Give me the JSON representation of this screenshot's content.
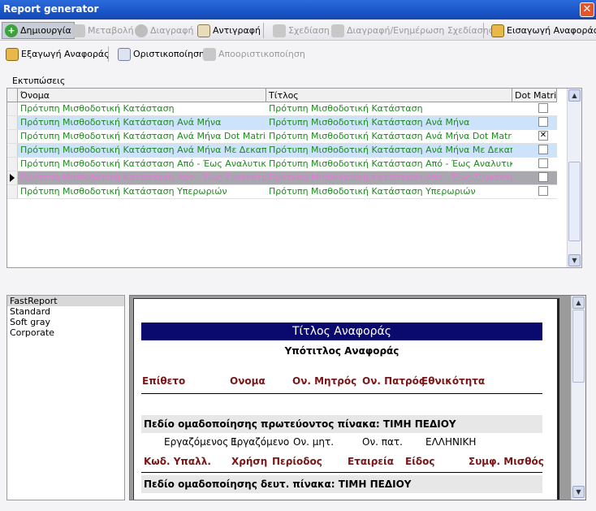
{
  "window": {
    "title": "Report generator",
    "close": "✕"
  },
  "toolbar1": {
    "create": "Δημιουργία",
    "edit": "Μεταβολή",
    "delete": "Διαγραφή",
    "copy": "Αντιγραφή",
    "design": "Σχεδίαση",
    "delete_update_design": "Διαγραφή/Ενημέρωση Σχεδίασης",
    "import": "Εισαγωγή Αναφοράς"
  },
  "toolbar2": {
    "export": "Εξαγωγή Αναφοράς",
    "finalize": "Οριστικοποίηση",
    "unfinalize": "Αποοριστικοποίηση"
  },
  "prints_label": "Εκτυπώσεις",
  "grid": {
    "columns": [
      "Όνομα",
      "Τίτλος",
      "Dot Matrix"
    ],
    "rows": [
      {
        "name": "Πρότυπη Μισθοδοτική Κατάσταση",
        "title": "Πρότυπη Μισθοδοτική Κατάσταση",
        "dot": ""
      },
      {
        "name": "Πρότυπη Μισθοδοτική Κατάσταση Ανά Μήνα",
        "title": "Πρότυπη Μισθοδοτική Κατάσταση Ανά Μήνα",
        "dot": ""
      },
      {
        "name": "Πρότυπη Μισθοδοτική Κατάσταση Ανά Μήνα Dot Matrix",
        "title": "Πρότυπη Μισθοδοτική Κατάσταση Ανά Μήνα Dot Matrix",
        "dot": "✕"
      },
      {
        "name": "Πρότυπη Μισθοδοτική Κατάσταση Ανά Μήνα Με Δεκαπενθήμερο",
        "title": "Πρότυπη Μισθοδοτική Κατάσταση Ανά Μήνα Με Δεκαπενθήμερο",
        "dot": ""
      },
      {
        "name": "Πρότυπη Μισθοδοτική Κατάσταση Από - Έως Αναλυτική",
        "title": "Πρότυπη Μισθοδοτική Κατάσταση Από - Έως Αναλυτική",
        "dot": ""
      },
      {
        "name": "Πρότυπη Μισθοδοτική Κατάσταση Από - Έως Συγκεντρωτική",
        "title": "Πρότυπη Μισθοδοτική Κατάσταση Από - Έως Συγκεντρωτική",
        "dot": ""
      },
      {
        "name": "Πρότυπη Μισθοδοτική Κατάσταση Υπερωριών",
        "title": "Πρότυπη Μισθοδοτική Κατάσταση Υπερωριών",
        "dot": ""
      }
    ]
  },
  "styles": [
    "FastReport",
    "Standard",
    "Soft gray",
    "Corporate"
  ],
  "preview": {
    "report_title": "Τίτλος Αναφοράς",
    "subtitle": "Υπότιτλος Αναφοράς",
    "master_headers": [
      "Επίθετο",
      "Ονομα",
      "Ον. Μητρός",
      "Ον. Πατρός",
      "Εθνικότητα"
    ],
    "group1": "Πεδίο ομαδοποίησης πρωτεύοντος πίνακα:  ΤΙΜΗ ΠΕΔΙΟΥ",
    "master_values": [
      "Εργαζόμενος 1",
      "Εργαζόμενο",
      "Ον. μητ.",
      "Ον. πατ.",
      "ΕΛΛΗΝΙΚΗ"
    ],
    "detail_headers": [
      "Κωδ. Υπαλλ.",
      "Χρήση",
      "Περίοδος",
      "Εταιρεία",
      "Είδος",
      "Συμφ. Μισθός"
    ],
    "group2": "Πεδίο ομαδοποίησης δευτ. πίνακα:  ΤΙΜΗ ΠΕΔΙΟΥ"
  },
  "colors": {
    "title_band": "#0a0a6e",
    "header_text": "#7a1518",
    "grid_text": "#1e8a1e",
    "selected_row_text": "#e37bd9"
  }
}
